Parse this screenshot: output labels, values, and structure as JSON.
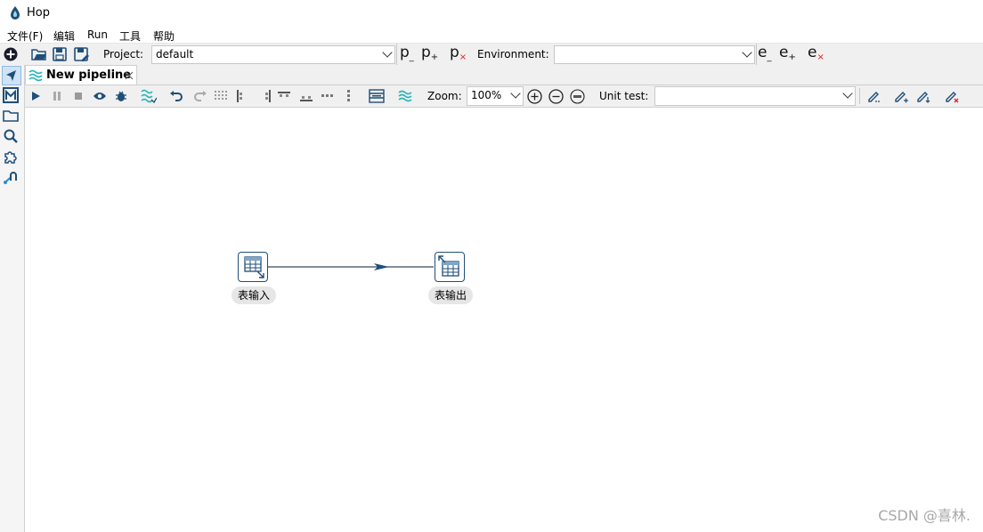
{
  "app": {
    "title": "Hop"
  },
  "menu": [
    "文件(F)",
    "编辑",
    "Run",
    "工具",
    "帮助"
  ],
  "mainbar": {
    "project_label": "Project:",
    "project_value": "default",
    "environment_label": "Environment:",
    "environment_value": "",
    "project_buttons": {
      "edit": "p",
      "add": "p",
      "delete": "p"
    },
    "env_buttons": {
      "edit": "e",
      "add": "e",
      "delete": "e"
    },
    "sub_edit": "_",
    "sub_add": "+",
    "sub_delete": "×"
  },
  "perspectives": [
    "explorer-perspective",
    "metadata-perspective",
    "file-perspective",
    "search-perspective",
    "plugin-perspective",
    "execution-perspective"
  ],
  "tab": {
    "label": "New pipeline"
  },
  "toolbar": {
    "zoom_label": "Zoom:",
    "zoom_value": "100%",
    "unit_test_label": "Unit test:",
    "unit_test_value": ""
  },
  "pipeline": {
    "nodes": [
      {
        "id": "table-input",
        "label": "表输入",
        "icon": "table-input-icon"
      },
      {
        "id": "table-output",
        "label": "表输出",
        "icon": "table-output-icon"
      }
    ],
    "hops": [
      {
        "from": "表输入",
        "to": "表输出"
      }
    ]
  },
  "colors": {
    "accent": "#1f4e79",
    "teal": "#2bb5b8",
    "delete": "#e02020"
  },
  "watermark": "CSDN @喜林."
}
